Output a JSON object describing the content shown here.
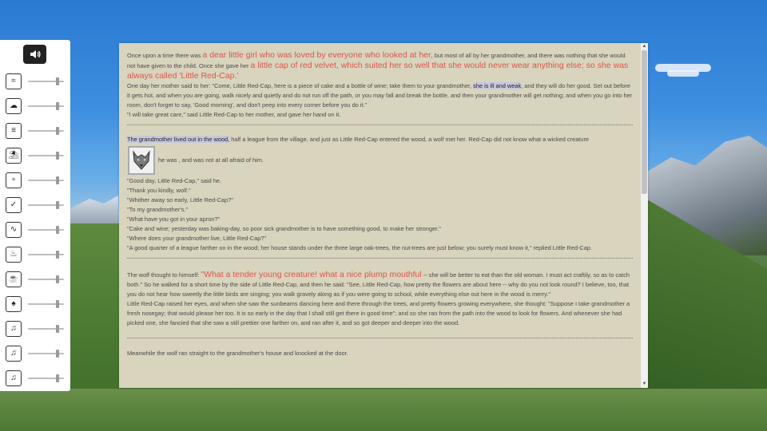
{
  "sound_panel": {
    "master_icon": "speaker-volume-icon",
    "sounds": [
      {
        "icon": "wind-icon",
        "glyph": "≈",
        "volume": 0.85
      },
      {
        "icon": "rain-cloud-icon",
        "glyph": "☁",
        "volume": 0.85
      },
      {
        "icon": "fog-icon",
        "glyph": "≡",
        "volume": 0.85
      },
      {
        "icon": "beach-umbrella-icon",
        "glyph": "⛱",
        "volume": 0.85
      },
      {
        "icon": "water-drops-icon",
        "glyph": "∘",
        "volume": 0.85
      },
      {
        "icon": "bird-icon",
        "glyph": "✓",
        "volume": 0.85
      },
      {
        "icon": "waves-icon",
        "glyph": "∿",
        "volume": 0.85
      },
      {
        "icon": "fire-icon",
        "glyph": "♨",
        "volume": 0.85
      },
      {
        "icon": "coffee-icon",
        "glyph": "☕",
        "volume": 0.85
      },
      {
        "icon": "forest-icon",
        "glyph": "♠",
        "volume": 0.85
      },
      {
        "icon": "music-note-icon",
        "glyph": "♫",
        "volume": 0.85
      },
      {
        "icon": "music-note-icon",
        "glyph": "♫",
        "volume": 0.85
      },
      {
        "icon": "music-note-icon",
        "glyph": "♫",
        "volume": 0.85
      }
    ]
  },
  "story": {
    "s1": {
      "a": "Once upon a time there was ",
      "b": "a dear little girl who was loved by everyone who looked at her,",
      "c": " but most of all by her grandmother, and there was nothing that she would not have given to the child. Once she gave her ",
      "d": "a little cap of red velvet, which suited her so well that she would never wear anything else; so she was always called 'Little Red-Cap.'",
      "e": "One day her mother said to her: \"Come, Little Red-Cap, here is a piece of cake and a bottle of wine; take them to your grandmother, ",
      "f": "she is ill and weak",
      "g": ", and they will do her good. Set out before it gets hot, and when you are going, walk nicely and quietly and do not run off the path, or you may fall and break the bottle, and then your grandmother will get nothing; and when you go into her room, don't forget to say, 'Good morning', and don't peep into every corner before you do it.\"",
      "h": "\"I will take great care,\" said Little Red-Cap to her mother, and gave her hand on it."
    },
    "s2": {
      "a": "The grandmother lived out in the wood,",
      "b": " half a league from the village, and just as Little Red-Cap entered the wood, a wolf met her. Red-Cap did not know what a wicked creature",
      "c": " he was , and was not at all afraid of him.",
      "lines": [
        "\"Good day, Little Red-Cap,\" said he.",
        "\"Thank you kindly, wolf.\"",
        "\"Whither away so early, Little Red-Cap?\"",
        "\"To my grandmother's.\"",
        "\"What have you got in your apron?\"",
        "\"Cake and wine; yesterday was baking-day, so poor sick grandmother is to have something good, to make her stronger.\"",
        "\"Where does your grandmother live, Little Red-Cap?\"",
        "\"A good quarter of a league farther on in the wood; her house stands under the three large oak-trees, the nut-trees are just below; you surely must know it,\" replied Little Red-Cap."
      ]
    },
    "s3": {
      "a": "The wolf thought to himself: ",
      "b": "\"What a tender young creature! what a nice plump mouthful",
      "c": " -- she will be better to eat than the old woman. I must act craftily, so as to catch both.\" So he walked for a short time by the side of Little Red-Cap, and then he said: \"See, Little Red-Cap, how pretty the flowers are about here -- why do you not look round? I believe, too, that you do not hear how sweetly the little birds are singing; you walk gravely along as if you were going to school, while everything else out here in the wood is merry.\"",
      "d": "Little Red-Cap raised her eyes, and when she saw the sunbeams dancing here and there through the trees, and pretty flowers growing everywhere, she thought: \"Suppose I take grandmother a fresh nosegay; that would please her too. It is so early in the day that I shall still get there in good time\"; and so she ran from the path into the wood to look for flowers. And whenever she had picked one, she fancied that she saw a still prettier one farther on, and ran after it, and so got deeper and deeper into the wood."
    },
    "s4": {
      "a": "Meanwhile the wolf ran straight to the grandmother's house and knocked at the door."
    }
  }
}
